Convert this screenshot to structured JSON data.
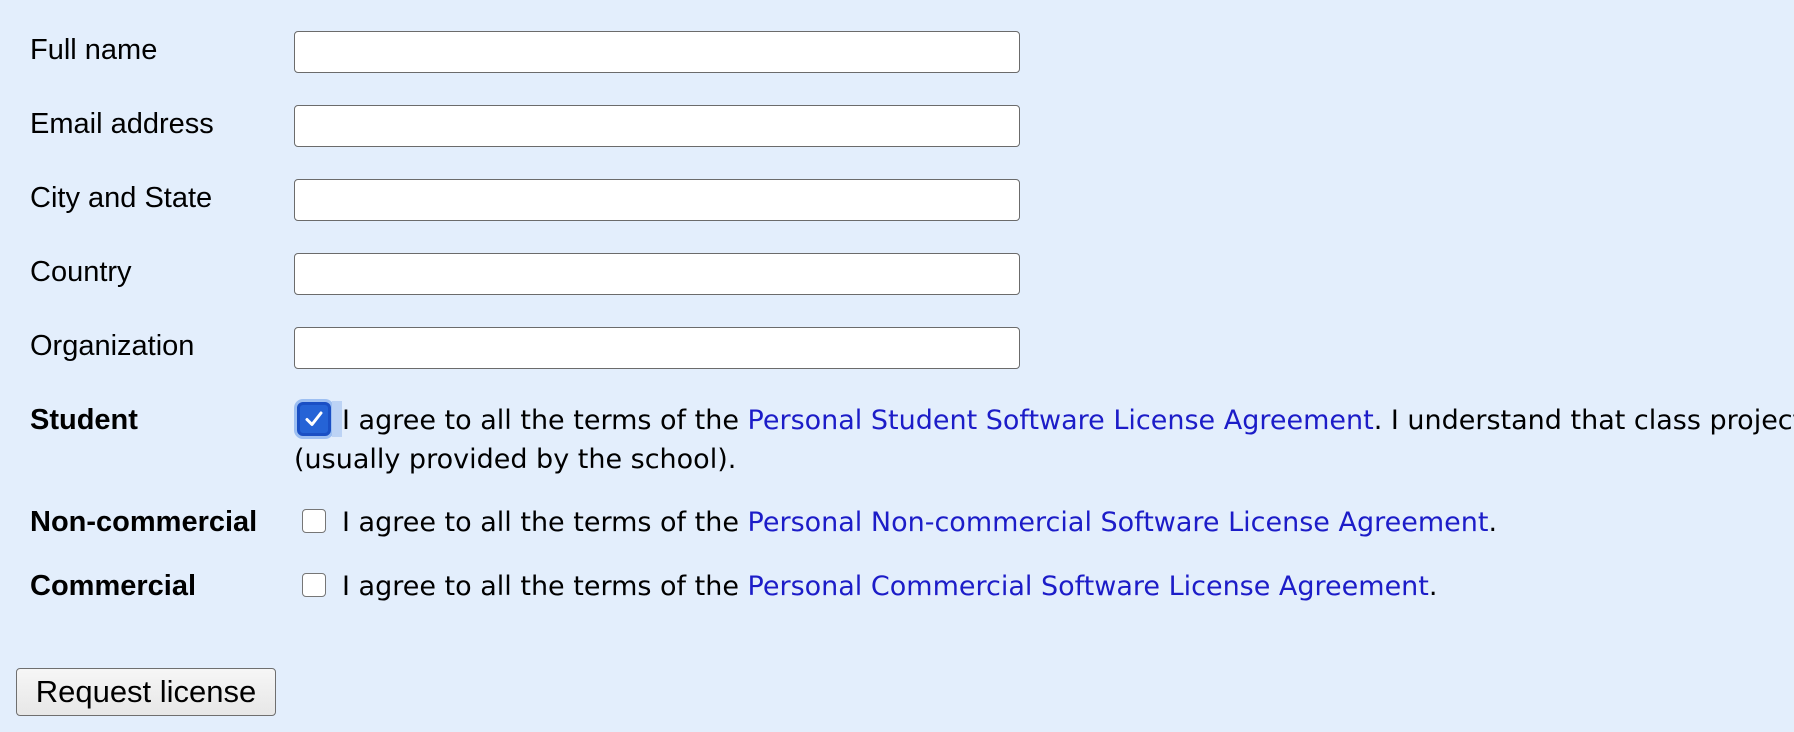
{
  "fields": [
    {
      "label": "Full name",
      "value": "",
      "placeholder": ""
    },
    {
      "label": "Email address",
      "value": "",
      "placeholder": ""
    },
    {
      "label": "City and State",
      "value": "",
      "placeholder": ""
    },
    {
      "label": "Country",
      "value": "",
      "placeholder": ""
    },
    {
      "label": "Organization",
      "value": "",
      "placeholder": ""
    }
  ],
  "licenses": {
    "student": {
      "label": "Student",
      "checked": true,
      "prefix": "I agree to all the terms of the ",
      "link": "Personal Student Software License Agreement",
      "suffix": ". I understand that class projects",
      "continuation": "(usually provided by the school)."
    },
    "noncommercial": {
      "label": "Non-commercial",
      "checked": false,
      "prefix": "I agree to all the terms of the ",
      "link": "Personal Non-commercial Software License Agreement",
      "suffix": "."
    },
    "commercial": {
      "label": "Commercial",
      "checked": false,
      "prefix": "I agree to all the terms of the ",
      "link": "Personal Commercial Software License Agreement",
      "suffix": "."
    }
  },
  "submit_label": "Request license",
  "colors": {
    "background": "#e3eefc",
    "link": "#1c1cc8",
    "checkbox_checked": "#2563d6"
  }
}
